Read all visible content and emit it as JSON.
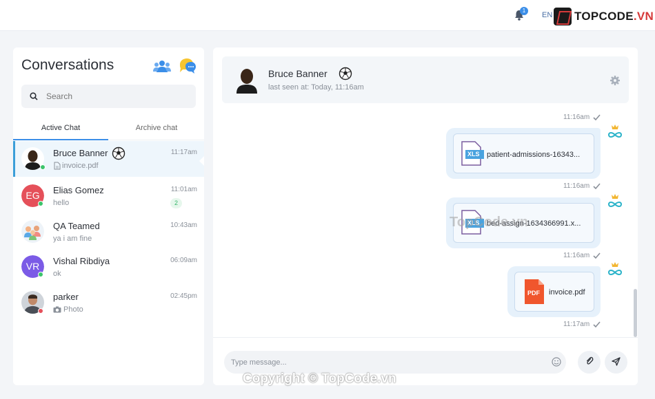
{
  "topbar": {
    "notification_count": "1",
    "language": "EN",
    "logo_text": "TOPCODE",
    "logo_suffix": ".VN"
  },
  "sidebar": {
    "title": "Conversations",
    "search_placeholder": "Search",
    "tabs": [
      {
        "label": "Active Chat",
        "active": true
      },
      {
        "label": "Archive chat",
        "active": false
      }
    ],
    "chats": [
      {
        "name": "Bruce Banner",
        "preview": "invoice.pdf",
        "time": "11:17am",
        "status_color": "#3cc46b",
        "avatar_type": "photo",
        "has_ball": true,
        "preview_icon": "file-icon",
        "active": true
      },
      {
        "name": "Elias Gomez",
        "preview": "hello",
        "time": "11:01am",
        "initials": "EG",
        "avatar_color": "#e5505a",
        "status_color": "#3cc46b",
        "unread": "2"
      },
      {
        "name": "QA Teamed",
        "preview": "ya i am fine",
        "time": "10:43am",
        "avatar_type": "group"
      },
      {
        "name": "Vishal Ribdiya",
        "preview": "ok",
        "time": "06:09am",
        "initials": "VR",
        "avatar_color": "#7b5be6",
        "status_color": "#3cc46b"
      },
      {
        "name": "parker",
        "preview": "Photo",
        "time": "02:45pm",
        "avatar_type": "photo2",
        "status_color": "#e5505a",
        "preview_icon": "camera-icon"
      }
    ]
  },
  "chat": {
    "contact_name": "Bruce Banner",
    "last_seen": "last seen at: Today, 11:16am",
    "messages": [
      {
        "time_top": "11:16am",
        "file_name": "patient-admissions-16343...",
        "file_type": "XLS",
        "time_bottom": "11:16am"
      },
      {
        "file_name": "bed-assign-1634366991.x...",
        "file_type": "XLS",
        "time_bottom": "11:16am"
      },
      {
        "file_name": "invoice.pdf",
        "file_type": "PDF",
        "time_bottom": "11:17am"
      }
    ],
    "composer_placeholder": "Type message..."
  },
  "watermark": {
    "footer": "Copyright © TopCode.vn",
    "middle": "TopCode.vn"
  },
  "colors": {
    "accent": "#3b8ee8",
    "online": "#3cc46b",
    "offline": "#e5505a"
  }
}
